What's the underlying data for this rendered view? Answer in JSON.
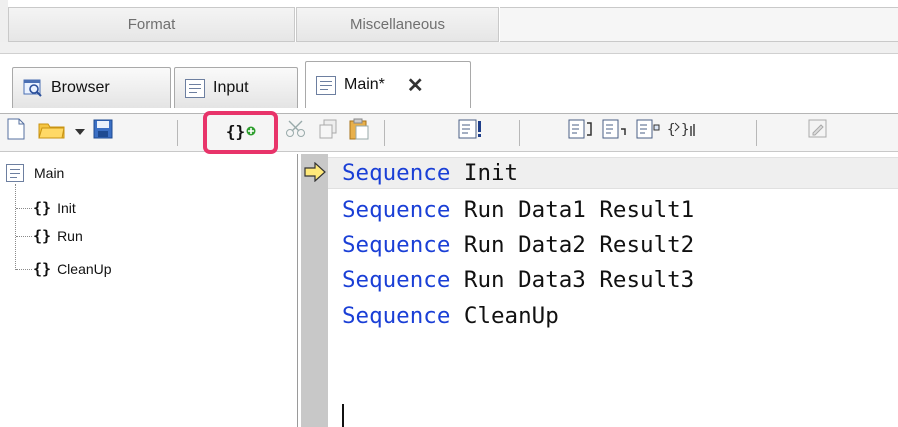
{
  "ribbon": {
    "groups": [
      "Format",
      "Miscellaneous"
    ]
  },
  "tabs": [
    {
      "label": "Browser",
      "icon": "browser-icon",
      "active": false
    },
    {
      "label": "Input",
      "icon": "document-icon",
      "active": false
    },
    {
      "label": "Main*",
      "icon": "document-icon",
      "active": true
    }
  ],
  "toolbar": {
    "add_sequence_label": "{}",
    "highlight_color": "#e8346a",
    "icons": [
      "new-document-icon",
      "open-folder-icon",
      "dropdown-arrow-icon",
      "save-icon",
      "add-sequence-icon",
      "cut-icon",
      "copy-icon",
      "paste-icon",
      "run-icon",
      "step-icon",
      "step-into-icon",
      "step-out-icon",
      "sequence-step-icon",
      "edit-icon"
    ]
  },
  "tree": {
    "root": "Main",
    "items": [
      {
        "braces": "{}",
        "label": "Init"
      },
      {
        "braces": "{}",
        "label": "Run"
      },
      {
        "braces": "{}",
        "label": "CleanUp"
      }
    ]
  },
  "editor": {
    "lines": [
      {
        "keyword": "Sequence",
        "rest": " Init"
      },
      {
        "keyword": "Sequence",
        "rest": " Run Data1 Result1"
      },
      {
        "keyword": "Sequence",
        "rest": " Run Data2 Result2"
      },
      {
        "keyword": "Sequence",
        "rest": " Run Data3 Result3"
      },
      {
        "keyword": "Sequence",
        "rest": " CleanUp"
      }
    ],
    "keyword_color": "#1a3fd6"
  }
}
